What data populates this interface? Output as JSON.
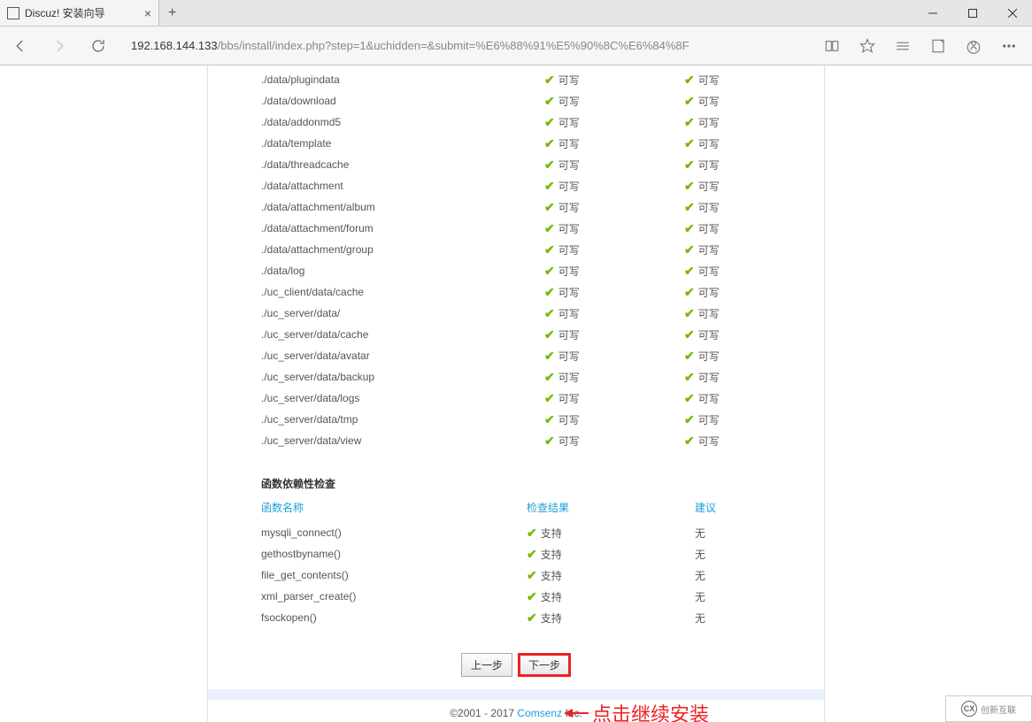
{
  "browser": {
    "tab_title": "Discuz! 安装向导",
    "url_host": "192.168.144.133",
    "url_path": "/bbs/install/index.php?step=1&uchidden=&submit=%E6%88%91%E5%90%8C%E6%84%8F"
  },
  "directories": [
    {
      "path": "./data/plugindata",
      "status": "可写",
      "demand": "可写"
    },
    {
      "path": "./data/download",
      "status": "可写",
      "demand": "可写"
    },
    {
      "path": "./data/addonmd5",
      "status": "可写",
      "demand": "可写"
    },
    {
      "path": "./data/template",
      "status": "可写",
      "demand": "可写"
    },
    {
      "path": "./data/threadcache",
      "status": "可写",
      "demand": "可写"
    },
    {
      "path": "./data/attachment",
      "status": "可写",
      "demand": "可写"
    },
    {
      "path": "./data/attachment/album",
      "status": "可写",
      "demand": "可写"
    },
    {
      "path": "./data/attachment/forum",
      "status": "可写",
      "demand": "可写"
    },
    {
      "path": "./data/attachment/group",
      "status": "可写",
      "demand": "可写"
    },
    {
      "path": "./data/log",
      "status": "可写",
      "demand": "可写"
    },
    {
      "path": "./uc_client/data/cache",
      "status": "可写",
      "demand": "可写"
    },
    {
      "path": "./uc_server/data/",
      "status": "可写",
      "demand": "可写"
    },
    {
      "path": "./uc_server/data/cache",
      "status": "可写",
      "demand": "可写"
    },
    {
      "path": "./uc_server/data/avatar",
      "status": "可写",
      "demand": "可写"
    },
    {
      "path": "./uc_server/data/backup",
      "status": "可写",
      "demand": "可写"
    },
    {
      "path": "./uc_server/data/logs",
      "status": "可写",
      "demand": "可写"
    },
    {
      "path": "./uc_server/data/tmp",
      "status": "可写",
      "demand": "可写"
    },
    {
      "path": "./uc_server/data/view",
      "status": "可写",
      "demand": "可写"
    }
  ],
  "func_section_title": "函数依赖性检查",
  "func_headers": {
    "name": "函数名称",
    "result": "检查结果",
    "suggest": "建议"
  },
  "functions": [
    {
      "name": "mysqli_connect()",
      "result": "支持",
      "suggest": "无"
    },
    {
      "name": "gethostbyname()",
      "result": "支持",
      "suggest": "无"
    },
    {
      "name": "file_get_contents()",
      "result": "支持",
      "suggest": "无"
    },
    {
      "name": "xml_parser_create()",
      "result": "支持",
      "suggest": "无"
    },
    {
      "name": "fsockopen()",
      "result": "支持",
      "suggest": "无"
    }
  ],
  "buttons": {
    "prev": "上一步",
    "next": "下一步"
  },
  "annotation": "点击继续安装",
  "footer": {
    "copyright": "©2001 - 2017 ",
    "link": "Comsenz",
    "suffix": " Inc."
  },
  "logo": "创新互联"
}
